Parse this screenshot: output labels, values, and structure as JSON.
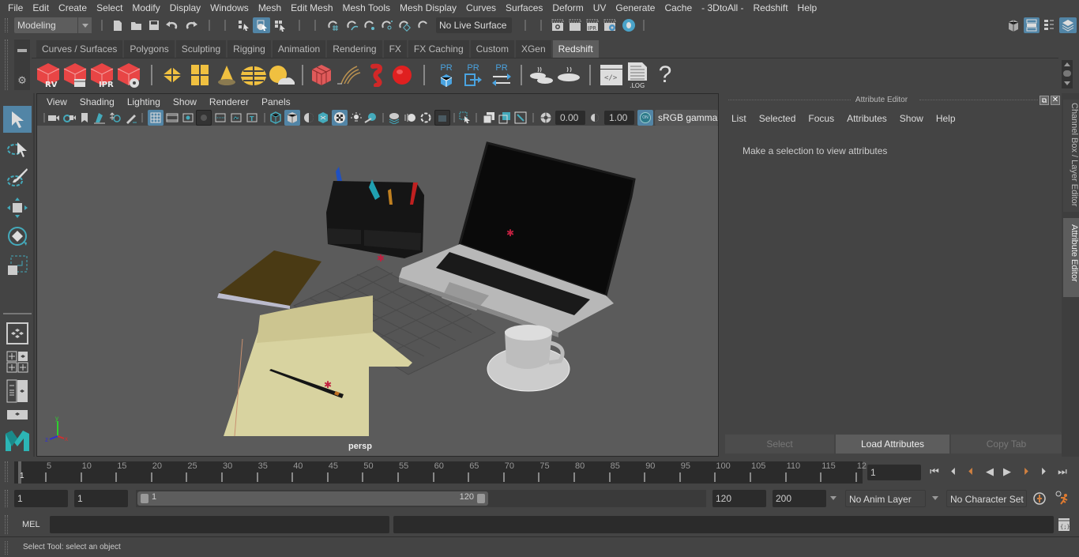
{
  "menubar": {
    "items": [
      "File",
      "Edit",
      "Create",
      "Select",
      "Modify",
      "Display",
      "Windows",
      "Mesh",
      "Edit Mesh",
      "Mesh Tools",
      "Mesh Display",
      "Curves",
      "Surfaces",
      "Deform",
      "UV",
      "Generate",
      "Cache",
      "- 3DtoAll -",
      "Redshift",
      "Help"
    ]
  },
  "statusline": {
    "menuset": "Modeling",
    "live_surface": "No Live Surface"
  },
  "shelf": {
    "tabs": [
      "Curves / Surfaces",
      "Polygons",
      "Sculpting",
      "Rigging",
      "Animation",
      "Rendering",
      "FX",
      "FX Caching",
      "Custom",
      "XGen",
      "Redshift"
    ],
    "active_tab": "Redshift",
    "icon_labels": {
      "rv": "RV",
      "ipr": "IPR",
      "pr": "PR",
      "log": ".LOG",
      "help": "?"
    }
  },
  "viewport": {
    "menu": [
      "View",
      "Shading",
      "Lighting",
      "Show",
      "Renderer",
      "Panels"
    ],
    "exposure": "0.00",
    "gamma": "1.00",
    "color_mgmt_on": "ON",
    "color_space": "sRGB gamma",
    "camera_label": "persp",
    "axis": {
      "x": "x",
      "y": "y",
      "z": "z"
    }
  },
  "attribute_editor": {
    "title": "Attribute Editor",
    "menu": [
      "List",
      "Selected",
      "Focus",
      "Attributes",
      "Show",
      "Help"
    ],
    "message": "Make a selection to view attributes",
    "buttons": {
      "select": "Select",
      "load": "Load Attributes",
      "copy": "Copy Tab"
    }
  },
  "side_tabs": {
    "channel_box": "Channel Box / Layer Editor",
    "attribute_editor": "Attribute Editor"
  },
  "timeline": {
    "start_frame_marker": "1",
    "ticks": [
      "5",
      "10",
      "15",
      "20",
      "25",
      "30",
      "35",
      "40",
      "45",
      "50",
      "55",
      "60",
      "65",
      "70",
      "75",
      "80",
      "85",
      "90",
      "95",
      "100",
      "105",
      "110",
      "115",
      "12"
    ],
    "current_frame": "1"
  },
  "range": {
    "start": "1",
    "playback_start": "1",
    "slider_min": "1",
    "slider_max": "120",
    "playback_end": "120",
    "end": "200",
    "anim_layer": "No Anim Layer",
    "character_set": "No Character Set"
  },
  "cmdline": {
    "label": "MEL",
    "input": "",
    "output": ""
  },
  "helpline": {
    "text": "Select Tool: select an object"
  }
}
